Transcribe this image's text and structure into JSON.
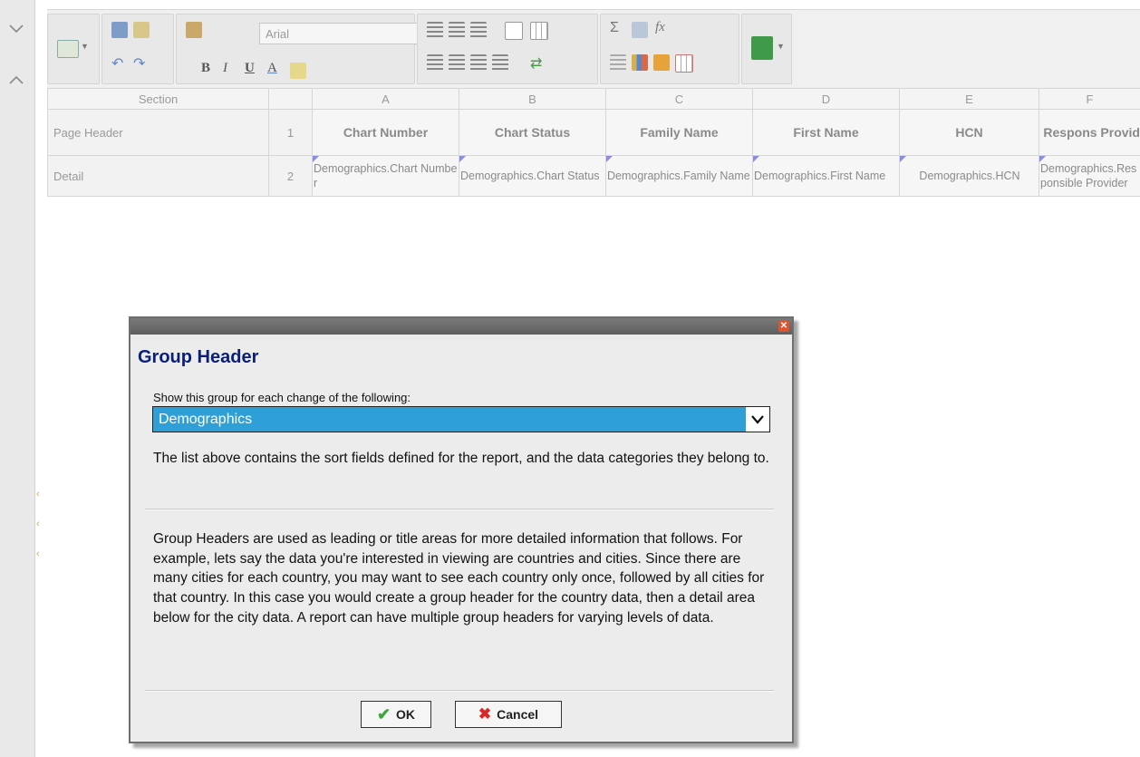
{
  "toolbar": {
    "font_name": "Arial",
    "format_letters": [
      "B",
      "I",
      "U",
      "A"
    ],
    "icons": [
      "report-settings-icon",
      "save-icon",
      "export-icon",
      "undo-icon",
      "redo-icon",
      "style-icon",
      "align-left-icon",
      "align-center-icon",
      "align-right-icon",
      "border-icon",
      "table-icon",
      "sum-icon",
      "image-icon",
      "function-icon",
      "chart-icon",
      "crosstab-icon",
      "excel-export-icon"
    ],
    "sum_glyph": "Σ",
    "fx_glyph": "fx"
  },
  "grid": {
    "section_header": "Section",
    "columns": [
      "A",
      "B",
      "C",
      "D",
      "E",
      "F"
    ],
    "rows": [
      {
        "section": "Page Header",
        "num": "1",
        "cells": [
          "Chart Number",
          "Chart Status",
          "Family Name",
          "First Name",
          "HCN",
          "Respons Provid"
        ]
      },
      {
        "section": "Detail",
        "num": "2",
        "cells": [
          "Demographics.Chart Number",
          "Demographics.Chart Status",
          "Demographics.Family Name",
          "Demographics.First Name",
          "Demographics.HCN",
          "Demographics.Responsible Provider"
        ]
      }
    ]
  },
  "dialog": {
    "title": "Group Header",
    "show_label": "Show this group for each change of the following:",
    "selected_group": "Demographics",
    "para1": "The list above contains the sort fields defined for the report, and the data categories they belong to.",
    "para2": "Group Headers are used as leading or title areas for more detailed information that follows. For example, lets say the data you're interested in viewing are countries and cities. Since there are many cities for each country, you may want to see each country only once, followed by all cities for that country. In this case you would create a group header for the country data, then a detail area below for the city data. A report can have multiple group headers for varying levels of data.",
    "ok_label": "OK",
    "cancel_label": "Cancel",
    "close_glyph": "✕"
  }
}
